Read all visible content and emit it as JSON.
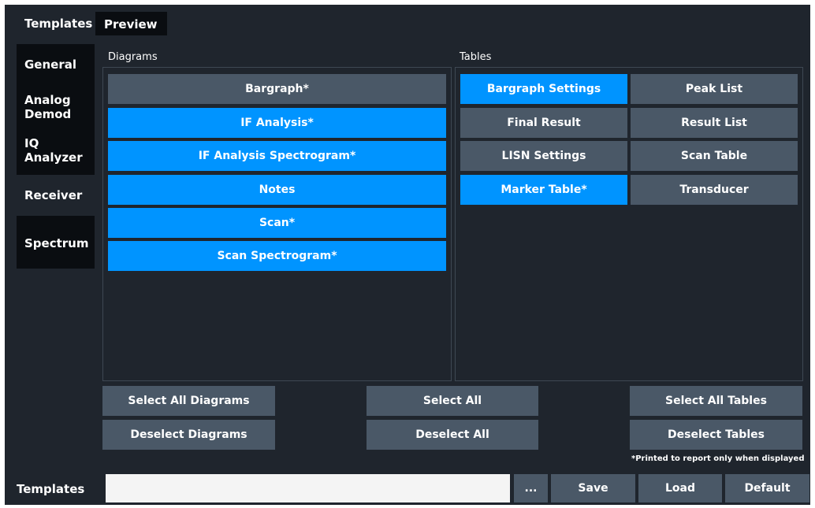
{
  "top_tabs": [
    {
      "label": "Templates",
      "active": true
    },
    {
      "label": "Preview",
      "active": false
    }
  ],
  "side_tabs": [
    {
      "label": "General",
      "active": false
    },
    {
      "label": "Analog\nDemod",
      "active": false
    },
    {
      "label": "IQ\nAnalyzer",
      "active": false
    },
    {
      "label": "Receiver",
      "active": true
    },
    {
      "label": "Spectrum",
      "active": false
    }
  ],
  "diagrams": {
    "label": "Diagrams",
    "items": [
      {
        "label": "Bargraph*",
        "selected": false
      },
      {
        "label": "IF Analysis*",
        "selected": true
      },
      {
        "label": "IF Analysis Spectrogram*",
        "selected": true
      },
      {
        "label": "Notes",
        "selected": true
      },
      {
        "label": "Scan*",
        "selected": true
      },
      {
        "label": "Scan Spectrogram*",
        "selected": true
      }
    ]
  },
  "tables": {
    "label": "Tables",
    "items": [
      {
        "label": "Bargraph Settings",
        "selected": true
      },
      {
        "label": "Peak List",
        "selected": false
      },
      {
        "label": "Final Result",
        "selected": false
      },
      {
        "label": "Result List",
        "selected": false
      },
      {
        "label": "LISN Settings",
        "selected": false
      },
      {
        "label": "Scan Table",
        "selected": false
      },
      {
        "label": "Marker Table*",
        "selected": true
      },
      {
        "label": "Transducer",
        "selected": false
      }
    ]
  },
  "actions": {
    "select_all_diagrams": "Select All Diagrams",
    "deselect_diagrams": "Deselect Diagrams",
    "select_all": "Select All",
    "deselect_all": "Deselect All",
    "select_all_tables": "Select All Tables",
    "deselect_tables": "Deselect Tables"
  },
  "note": "*Printed to report only when displayed",
  "footer": {
    "templates_label": "Templates",
    "template_value": "",
    "browse_label": "...",
    "save_label": "Save",
    "load_label": "Load",
    "default_label": "Default"
  },
  "colors": {
    "background": "#1f252d",
    "selected": "#0094ff",
    "unselected": "#4a5867",
    "tab_inactive": "#0a0d11"
  }
}
